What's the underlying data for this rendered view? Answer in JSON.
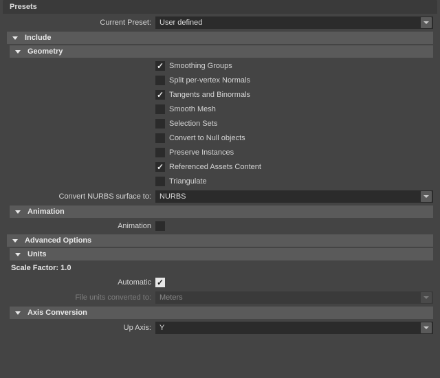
{
  "presets": {
    "header": "Presets",
    "current_label": "Current Preset:",
    "current_value": "User defined"
  },
  "include": {
    "header": "Include"
  },
  "geometry": {
    "header": "Geometry",
    "checkboxes": [
      {
        "label": "Smoothing Groups",
        "checked": true
      },
      {
        "label": "Split per-vertex Normals",
        "checked": false
      },
      {
        "label": "Tangents and Binormals",
        "checked": true
      },
      {
        "label": "Smooth Mesh",
        "checked": false
      },
      {
        "label": "Selection Sets",
        "checked": false
      },
      {
        "label": "Convert to Null objects",
        "checked": false
      },
      {
        "label": "Preserve Instances",
        "checked": false
      },
      {
        "label": "Referenced Assets Content",
        "checked": true
      },
      {
        "label": "Triangulate",
        "checked": false
      }
    ],
    "convert_nurbs_label": "Convert NURBS surface to:",
    "convert_nurbs_value": "NURBS"
  },
  "animation": {
    "header": "Animation",
    "label": "Animation",
    "checked": false
  },
  "advanced": {
    "header": "Advanced Options"
  },
  "units": {
    "header": "Units",
    "scale_factor": "Scale Factor: 1.0",
    "automatic_label": "Automatic",
    "automatic_checked": true,
    "file_units_label": "File units converted to:",
    "file_units_value": "Meters"
  },
  "axis": {
    "header": "Axis Conversion",
    "up_axis_label": "Up Axis:",
    "up_axis_value": "Y"
  }
}
